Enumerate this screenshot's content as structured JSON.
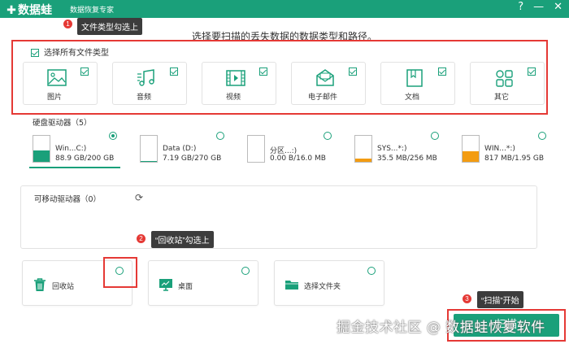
{
  "app": {
    "logo_text": "数据蛙",
    "subtitle": "数据恢复专家",
    "help_symbol": "?",
    "minimize_symbol": "—",
    "close_symbol": "✕"
  },
  "page_title": "选择要扫描的丢失数据的数据类型和路径。",
  "callouts": [
    {
      "num": "1",
      "text": "文件类型勾选上"
    },
    {
      "num": "2",
      "text": "“回收站”勾选上"
    },
    {
      "num": "3",
      "text": "“扫描”开始"
    }
  ],
  "file_types": {
    "select_all_label": "选择所有文件类型",
    "items": [
      {
        "label": "图片",
        "icon": "image-icon",
        "checked": true
      },
      {
        "label": "音频",
        "icon": "music-icon",
        "checked": true
      },
      {
        "label": "视频",
        "icon": "video-icon",
        "checked": true
      },
      {
        "label": "电子邮件",
        "icon": "email-icon",
        "checked": true
      },
      {
        "label": "文档",
        "icon": "document-icon",
        "checked": true
      },
      {
        "label": "其它",
        "icon": "others-icon",
        "checked": true
      }
    ]
  },
  "hard_drives": {
    "title": "硬盘驱动器（5）",
    "items": [
      {
        "name": "Win...C:)",
        "size": "88.9 GB/200 GB",
        "selected": true,
        "fill_fraction": 0.44,
        "color": "#1aa07a"
      },
      {
        "name": "Data (D:)",
        "size": "7.19 GB/270 GB",
        "selected": false,
        "fill_fraction": 0.03,
        "color": "#1aa07a"
      },
      {
        "name": "分区...:)",
        "size": "0.00  B/16.0 MB",
        "selected": false,
        "fill_fraction": 0.0,
        "color": "#f39c12"
      },
      {
        "name": "SYS...*:)",
        "size": "35.5 MB/256 MB",
        "selected": false,
        "fill_fraction": 0.14,
        "color": "#f39c12"
      },
      {
        "name": "WIN...*:)",
        "size": "817 MB/1.95 GB",
        "selected": false,
        "fill_fraction": 0.42,
        "color": "#f39c12"
      }
    ]
  },
  "removable": {
    "title": "可移动驱动器（0）",
    "refresh_symbol": "⟳"
  },
  "locations": [
    {
      "label": "回收站",
      "icon": "trash-icon"
    },
    {
      "label": "桌面",
      "icon": "desktop-icon"
    },
    {
      "label": "选择文件夹",
      "icon": "folder-icon"
    }
  ],
  "watermark": "掘金技术社区 @ 数据蛙恢复软件",
  "scan_button": "扫描",
  "colors": {
    "accent": "#1aa07a",
    "highlight": "#e53935",
    "warning": "#f39c12"
  }
}
